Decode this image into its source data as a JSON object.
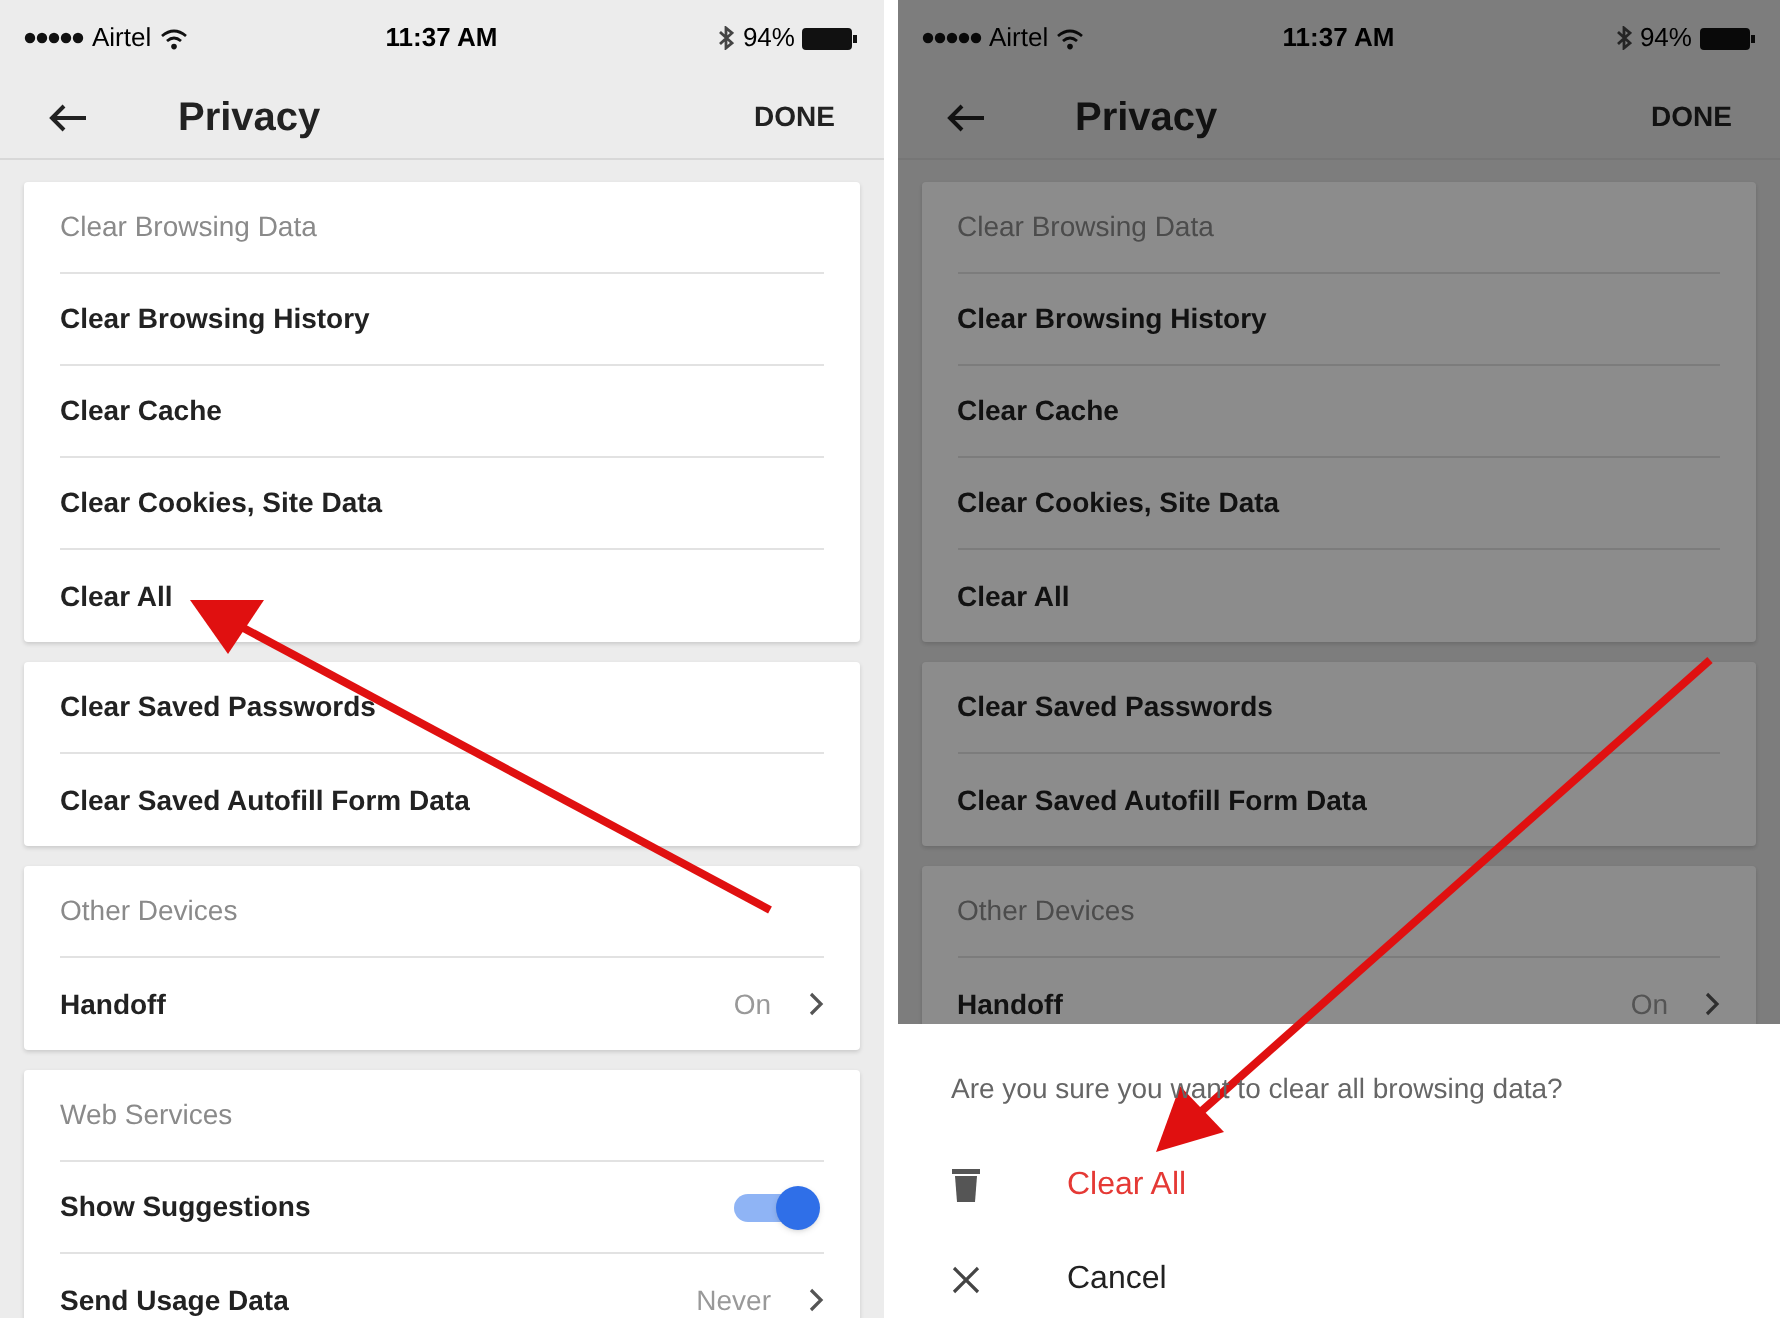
{
  "screens": [
    {
      "status_bar": {
        "carrier": "Airtel",
        "time": "11:37 AM",
        "battery": "94%"
      },
      "header": {
        "title": "Privacy",
        "action": "DONE"
      },
      "dimmed": false,
      "sections": [
        {
          "title": "Clear Browsing Data",
          "rows": [
            {
              "kind": "link",
              "label": "Clear Browsing History"
            },
            {
              "kind": "link",
              "label": "Clear Cache"
            },
            {
              "kind": "link",
              "label": "Clear Cookies, Site Data"
            },
            {
              "kind": "link",
              "label": "Clear All"
            }
          ]
        },
        {
          "rows": [
            {
              "kind": "link",
              "label": "Clear Saved Passwords"
            },
            {
              "kind": "link",
              "label": "Clear Saved Autofill Form Data"
            }
          ]
        },
        {
          "title": "Other Devices",
          "rows": [
            {
              "kind": "value",
              "label": "Handoff",
              "value": "On"
            }
          ]
        },
        {
          "title": "Web Services",
          "rows": [
            {
              "kind": "toggle",
              "label": "Show Suggestions",
              "on": true
            },
            {
              "kind": "value",
              "label": "Send Usage Data",
              "value": "Never"
            }
          ]
        }
      ]
    },
    {
      "status_bar": {
        "carrier": "Airtel",
        "time": "11:37 AM",
        "battery": "94%"
      },
      "header": {
        "title": "Privacy",
        "action": "DONE"
      },
      "dimmed": true,
      "sections": [
        {
          "title": "Clear Browsing Data",
          "rows": [
            {
              "kind": "link",
              "label": "Clear Browsing History"
            },
            {
              "kind": "link",
              "label": "Clear Cache"
            },
            {
              "kind": "link",
              "label": "Clear Cookies, Site Data"
            },
            {
              "kind": "link",
              "label": "Clear All"
            }
          ]
        },
        {
          "rows": [
            {
              "kind": "link",
              "label": "Clear Saved Passwords"
            },
            {
              "kind": "link",
              "label": "Clear Saved Autofill Form Data"
            }
          ]
        },
        {
          "title": "Other Devices",
          "rows": [
            {
              "kind": "value",
              "label": "Handoff",
              "value": "On"
            }
          ]
        }
      ],
      "sheet": {
        "question": "Are you sure you want to clear all browsing data?",
        "actions": [
          {
            "kind": "destructive",
            "label": "Clear All"
          },
          {
            "kind": "cancel",
            "label": "Cancel"
          }
        ]
      }
    }
  ]
}
